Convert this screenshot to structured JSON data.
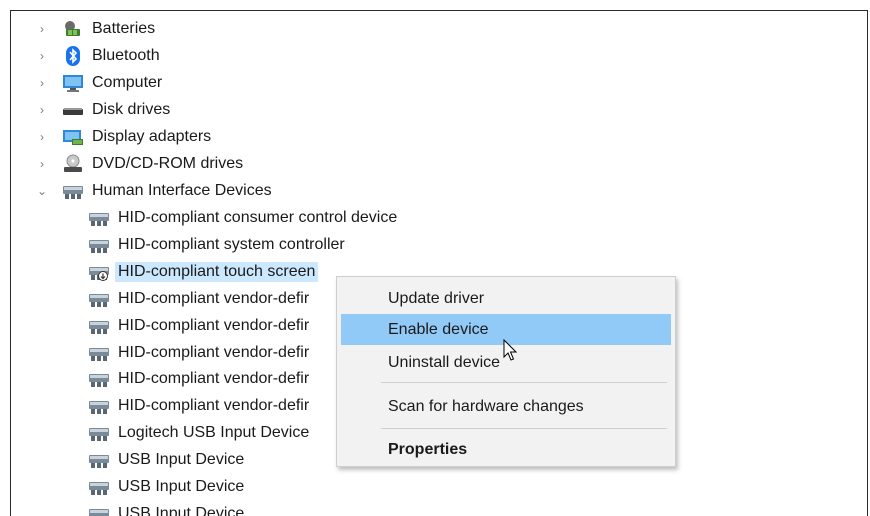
{
  "tree": {
    "categories": [
      {
        "label": "Batteries",
        "icon": "battery-icon",
        "expanded": false
      },
      {
        "label": "Bluetooth",
        "icon": "bluetooth-icon",
        "expanded": false
      },
      {
        "label": "Computer",
        "icon": "computer-icon",
        "expanded": false
      },
      {
        "label": "Disk drives",
        "icon": "disk-drive-icon",
        "expanded": false
      },
      {
        "label": "Display adapters",
        "icon": "display-adapter-icon",
        "expanded": false
      },
      {
        "label": "DVD/CD-ROM drives",
        "icon": "dvd-drive-icon",
        "expanded": false
      },
      {
        "label": "Human Interface Devices",
        "icon": "hid-icon",
        "expanded": true
      }
    ],
    "hid_children": [
      {
        "label": "HID-compliant consumer control device",
        "icon": "hid-device-icon"
      },
      {
        "label": "HID-compliant system controller",
        "icon": "hid-device-icon"
      },
      {
        "label": "HID-compliant touch screen",
        "icon": "hid-device-disabled-icon",
        "selected": true
      },
      {
        "label": "HID-compliant vendor-defir",
        "icon": "hid-device-icon"
      },
      {
        "label": "HID-compliant vendor-defir",
        "icon": "hid-device-icon"
      },
      {
        "label": "HID-compliant vendor-defir",
        "icon": "hid-device-icon"
      },
      {
        "label": "HID-compliant vendor-defir",
        "icon": "hid-device-icon"
      },
      {
        "label": "HID-compliant vendor-defir",
        "icon": "hid-device-icon"
      },
      {
        "label": "Logitech USB Input Device",
        "icon": "hid-device-icon"
      },
      {
        "label": "USB Input Device",
        "icon": "hid-device-icon"
      },
      {
        "label": "USB Input Device",
        "icon": "hid-device-icon"
      },
      {
        "label": "USB Input Device",
        "icon": "hid-device-icon"
      }
    ]
  },
  "context_menu": {
    "update_driver": "Update driver",
    "enable_device": "Enable device",
    "uninstall_device": "Uninstall device",
    "scan_hardware": "Scan for hardware changes",
    "properties": "Properties"
  },
  "colors": {
    "menu_highlight": "#91c9f7",
    "selection": "#cce8ff",
    "menu_bg": "#f2f2f2"
  }
}
